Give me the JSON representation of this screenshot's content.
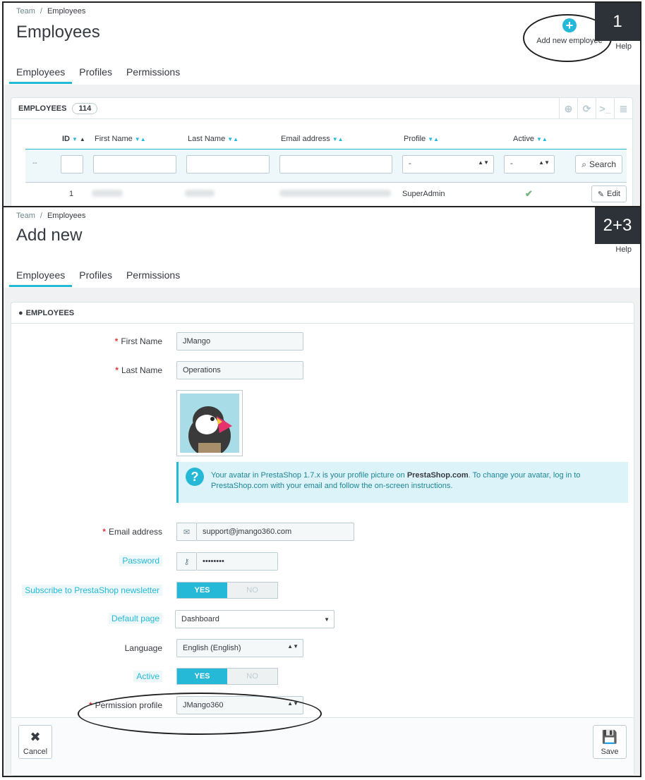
{
  "step1": {
    "number": "1",
    "breadcrumb": [
      "Team",
      "Employees"
    ],
    "title": "Employees",
    "add_new": "Add new employee",
    "help": "Help",
    "tabs": [
      "Employees",
      "Profiles",
      "Permissions"
    ],
    "panel_title": "EMPLOYEES",
    "count": "114",
    "columns": [
      "ID",
      "First Name",
      "Last Name",
      "Email address",
      "Profile",
      "Active"
    ],
    "filter_dash": "--",
    "select_placeholder": "-",
    "search_label": "Search",
    "row": {
      "id": "1",
      "profile": "SuperAdmin",
      "edit_label": "Edit"
    }
  },
  "step2": {
    "number": "2+3",
    "breadcrumb": [
      "Team",
      "Employees"
    ],
    "title": "Add new",
    "help": "Help",
    "tabs": [
      "Employees",
      "Profiles",
      "Permissions"
    ],
    "panel_title": "EMPLOYEES",
    "form": {
      "first_name_label": "First Name",
      "first_name_value": "JMango",
      "last_name_label": "Last Name",
      "last_name_value": "Operations",
      "info_text_1": "Your avatar in PrestaShop 1.7.x is your profile picture on ",
      "info_link": "PrestaShop.com",
      "info_text_2": ". To change your avatar, log in to PrestaShop.com with your email and follow the on-screen instructions.",
      "email_label": "Email address",
      "email_value": "support@jmango360.com",
      "password_label": "Password",
      "password_value": "••••••••",
      "newsletter_label": "Subscribe to PrestaShop newsletter",
      "yes": "YES",
      "no": "NO",
      "default_page_label": "Default page",
      "default_page_value": "Dashboard",
      "language_label": "Language",
      "language_value": "English (English)",
      "active_label": "Active",
      "permission_label": "Permission profile",
      "permission_value": "JMango360"
    },
    "cancel_label": "Cancel",
    "save_label": "Save"
  }
}
